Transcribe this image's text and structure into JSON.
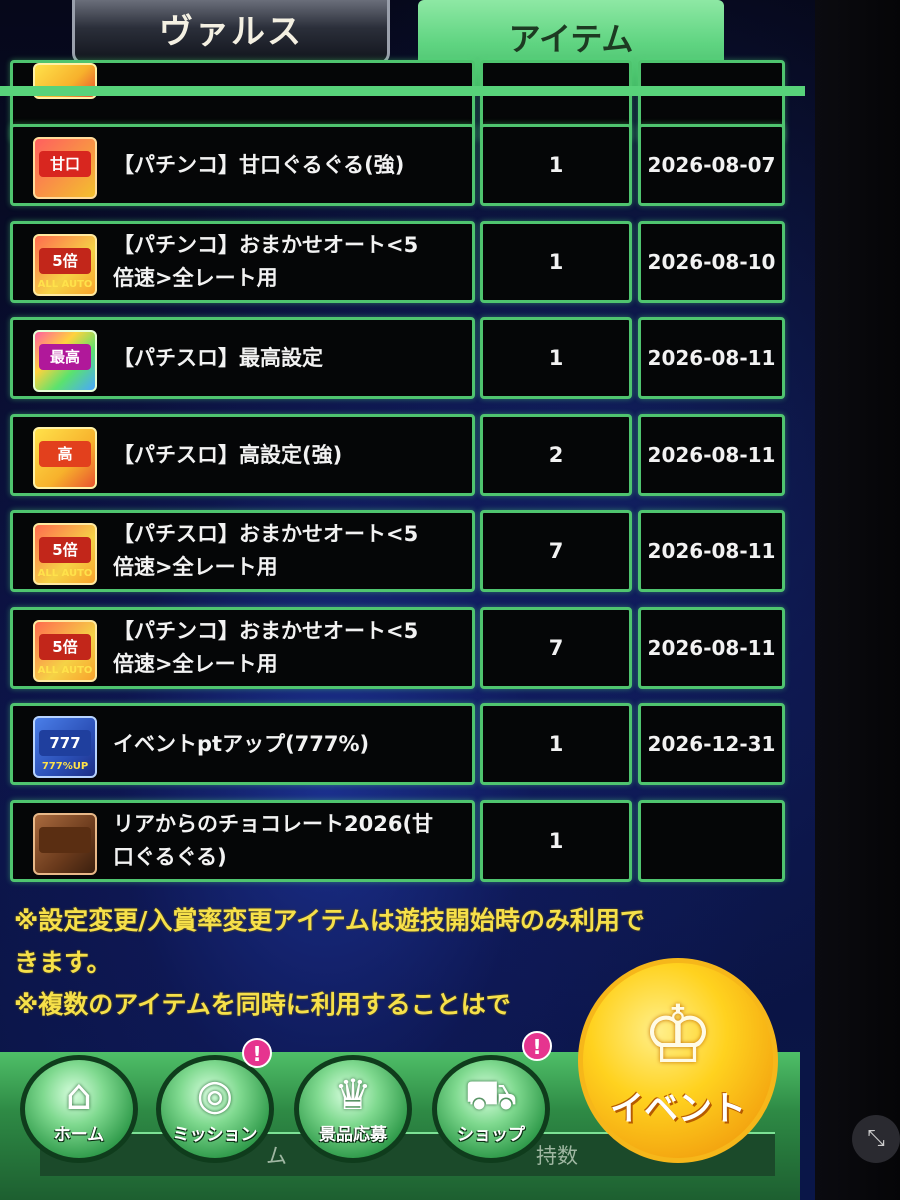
{
  "tabs": {
    "valz": "ヴァルス",
    "item": "アイテム"
  },
  "items": [
    {
      "name": "【パチンコ】甘口ぐるぐる(強)",
      "qty": "1",
      "expiry": "2026-08-07",
      "icon": "sweet-spin-icon",
      "badge": "甘口",
      "foot": ""
    },
    {
      "name": "【パチンコ】おまかせオート<5\n倍速>全レート用",
      "qty": "1",
      "expiry": "2026-08-10",
      "icon": "auto-play-icon",
      "badge": "5倍",
      "foot": "ALL AUTO"
    },
    {
      "name": "【パチスロ】最高設定",
      "qty": "1",
      "expiry": "2026-08-11",
      "icon": "max-setting-icon",
      "badge": "最高",
      "foot": ""
    },
    {
      "name": "【パチスロ】高設定(強)",
      "qty": "2",
      "expiry": "2026-08-11",
      "icon": "high-setting-icon",
      "badge": "高",
      "foot": ""
    },
    {
      "name": "【パチスロ】おまかせオート<5\n倍速>全レート用",
      "qty": "7",
      "expiry": "2026-08-11",
      "icon": "auto-play-icon",
      "badge": "5倍",
      "foot": "ALL AUTO"
    },
    {
      "name": "【パチンコ】おまかせオート<5\n倍速>全レート用",
      "qty": "7",
      "expiry": "2026-08-11",
      "icon": "auto-play-icon",
      "badge": "5倍",
      "foot": "ALL AUTO"
    },
    {
      "name": "イベントptアップ(777%)",
      "qty": "1",
      "expiry": "2026-12-31",
      "icon": "event-pt-up-icon",
      "badge": "777",
      "foot": "777%UP"
    },
    {
      "name": "リアからのチョコレート2026(甘\n口ぐるぐる)",
      "qty": "1",
      "expiry": "",
      "icon": "chocolate-icon",
      "badge": "",
      "foot": ""
    }
  ],
  "notes": [
    "※設定変更/入賞率変更アイテムは遊技開始時のみ利用で",
    "きます。",
    "※複数のアイテムを同時に利用することはで"
  ],
  "nav": {
    "home": "ホーム",
    "mission": "ミッション",
    "prize": "景品応募",
    "shop": "ショップ",
    "event": "イベント",
    "notif_badge": "!",
    "strip_left": "ム",
    "strip_right": "持数"
  },
  "colors": {
    "accent_green": "#58d27a",
    "cell_border": "#4fc46f",
    "note_text": "#f6e04a",
    "notification": "#e6348f",
    "event_gold": "#ffd21f"
  }
}
